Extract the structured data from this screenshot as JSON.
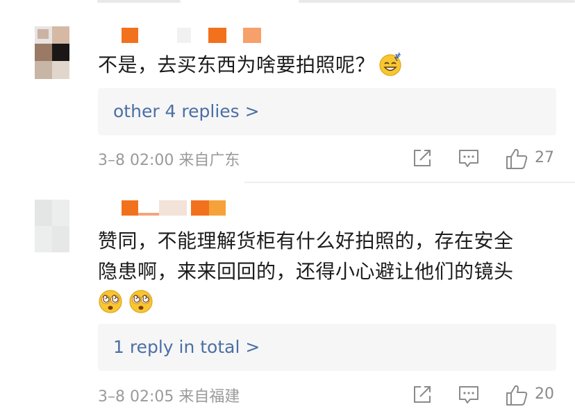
{
  "comments": [
    {
      "text": "不是，去买东西为啥要拍照呢？",
      "replies_link": "other 4 replies >",
      "timestamp": "3–8 02:00",
      "location": "来自广东",
      "like_count": "27",
      "emoji": [
        "sweat-smile-emoji"
      ]
    },
    {
      "text_line1": "赞同，不能理解货柜有什么好拍照的，存在安全",
      "text_line2": "隐患啊，来来回回的，还得小心避让他们的镜头",
      "replies_link": "1 reply in total >",
      "timestamp": "3–8 02:05",
      "location": "来自福建",
      "like_count": "20",
      "emoji": [
        "dizzy-eyes-emoji",
        "dizzy-eyes-emoji"
      ]
    }
  ],
  "icons": {
    "share": "share-icon",
    "comment": "comment-icon",
    "like": "thumbs-up-icon"
  },
  "colors": {
    "link": "#4a6fa5",
    "meta": "#9a9a9a",
    "name_mosaic_orange": "#f2711c",
    "reply_bg": "#f6f6f6"
  }
}
